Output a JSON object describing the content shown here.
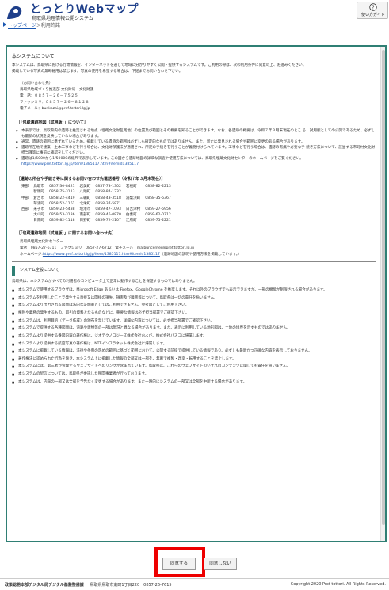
{
  "header": {
    "title": "とっとりWebマップ",
    "subtitle": "鳥取県地理情報公開システム",
    "help_label": "使い方ガイド"
  },
  "breadcrumb": {
    "home": "トップページ",
    "separator": "＞",
    "current": "利用許諾"
  },
  "content": {
    "title": "本システムについて",
    "intro": [
      "本システムは、鳥取県における行政情報を、インターネットを通じて地域に分かりやすく公開・提供するシステムです。ご利用の際は、次の利用条件に同意の上、お進みください。",
      "掲載している写真の無断転用は禁じます。写真の使用を希望する場合は、下記までお問い合わせ下さい。"
    ],
    "contact_head": "（お問い合わせ先）",
    "contact_lines": [
      "鳥取県地域づくり推進部 文化財局　文化財課",
      "電　話：０８５７－２６－７５２５",
      "ファクシミリ：０８５７－２６－８１２８",
      "電子メール：bunkazai@pref.tottori.lg.jp"
    ],
    "heritage_title": "［「包蔵遺跡地図（試用版）」について］",
    "heritage_items": [
      "本表示では、鳥取県内の遺跡と推定される地点（埋蔵文化財包蔵地）の位置及び範囲とその概要を知ることができます。なお、各遺跡の概要は、令和７年３月末現在のとこ ろ、試用版としての公開であるため、必ずしも最新の状況を反映していない場合があります。",
      "通常、遺跡の範囲に準ずれているため、掲載している遺跡の範囲は必ずしも確定的なものではありません。また、新たに発見される場合や範囲に変更のある場合があります。",
      "遺跡所在地で建築・土木工事などを行う場合は、文化財保護法が適用され、所定の手続きを行うことが義務付けられています。工事などを行う場合は、遺跡の有無や必要な手 続き方法について、該当する市町村文化財担当課等に事前に確認をしてください。",
      "遺跡は1/5000から1/50000の縮尺で表示しています。この図から遺跡地図の詳細な調査や使用方法については、鳥取県埋蔵文化財センターのホームページをご覧ください。"
    ],
    "heritage_link": "https://www.pref.tottori.lg.jp/item/1385117.htm#itemid1385117",
    "dept_title": "［遺跡の所在や手続き等に関するお問い合わせ先電話番号（令和７年３月末現在）］",
    "dept_rows": [
      [
        "東部",
        "鳥取市",
        "0857-30-8421",
        "岩美町",
        "0857-73-1302",
        "若桜町",
        "0858-82-2213"
      ],
      [
        "",
        "智頭町",
        "0858-75-3113",
        "八頭町",
        "0858-84-1232",
        "",
        ""
      ],
      [
        "中部",
        "倉吉市",
        "0858-22-4419",
        "三朝町",
        "0858-43-3518",
        "湯梨浜町",
        "0858-35-5367"
      ],
      [
        "",
        "琴浦町",
        "0858-52-1161",
        "北栄町",
        "0858-37-5871",
        "",
        ""
      ],
      [
        "西部",
        "米子市",
        "0859-23-5438",
        "境港市",
        "0859-47-1093",
        "日吉津村",
        "0859-27-5956"
      ],
      [
        "",
        "大山町",
        "0859-53-3136",
        "南部町",
        "0859-46-0870",
        "伯耆町",
        "0859-62-0712"
      ],
      [
        "",
        "日南町",
        "0859-82-1118",
        "日野町",
        "0859-72-2107",
        "江府町",
        "0859-75-2221"
      ]
    ],
    "center_title": "［「包蔵遺跡地図（試用版）」に関するお問い合わせ先］",
    "center_lines": [
      "鳥取県埋蔵文化財センター",
      "電話　0857-27-6711　ファクシミリ　0857-27-6712　電子メール　maibuncenter@pref.tottori.lg.jp"
    ],
    "center_link_prefix": "ホームページ:",
    "center_link": "https://www.pref.tottori.lg.jp/item/1385117.htm#itemid1385117",
    "center_link_suffix": "（遺跡地図の説明や使用方法を掲載しています。）",
    "system_title": "システム全般について",
    "system_intro": "鳥取県は、本システムがすべての利用者のコンピュータ上で正常に動作することを保証するものではありません。",
    "system_items": [
      "本システムで使用するブラウザは、Microsoft Edge あるいは Firefox、GoogleChrome を推奨します。それ以外のブラウザでも表示できますが、一部の機能が制限される場合があります。",
      "本システムを利用したことで発生する直接又は間接の損失、損害及び障害等について、鳥取県は一切の責任を負いません。",
      "本システムより出力される図面は法的な証明書としてはご利用できません。参考図としてご利用下さい。",
      "権利や義務の発生するもの、取引の資料となるものなどに、重要な情報は必ず担当部署でご確認下さい。",
      "本システムは、利用目的（データ作成）の頒布を禁じています。詳細な内容については、必ず担当部署でご確認下さい。",
      "本システムで提供する各種図面は、道路や建物等の一部は現況と異なる場合があります。また、表示に利用している地形図は、土地の境界を示すものではありません。",
      "本システムより提供する番図内容の著作権は、ジオテクノロジーズ株式会社および、株式会社パスコに帰属します。",
      "本システムより提供する航空写真の著作権は、NTTインフラネット株式会社に帰属します。",
      "本システムに掲載している情報は、法律や条例の定めの範囲に基づく範囲において、公開する前提で提供している情報であり、必ずしも最新かつ正確な内容を表示しておりません。",
      "著作権法に認められた行為を除き、本システム上に掲載した情報の全部又は一部を、無断で複製・改変・転用することを禁止します。",
      "本システムには、第三者が管理するウェブサイトへのリンクが含まれています。鳥取県は、これらのウェブサイトのいずれのコンテンツに関しても責任を負いません。",
      "本システムの配信については、鳥取県が委託した民間事業者が行っております。",
      "本システムは、内容の一部又は全部を予告なく変更する場合があります。また一時的にシステムの一部又は全部を中断する場合があります。"
    ]
  },
  "buttons": {
    "agree": "同意する",
    "disagree": "同意しない"
  },
  "footer": {
    "org": "政策総務本部デジタル局デジタル基盤整備課",
    "address": "鳥取県鳥取市東町1丁目220　0857-26-7615",
    "copyright": "Copyright 2020 Pref tottori. All Rights Reserved."
  }
}
